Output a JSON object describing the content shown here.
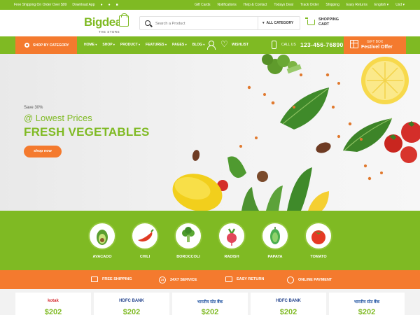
{
  "topbar": {
    "shipping_note": "Free Shipping On Order Over $99",
    "download_label": "Download App",
    "links": [
      "Gift Cards",
      "Notifications",
      "Help & Contact",
      "Todays Deal",
      "Track Order",
      "Shipping",
      "Easy Returns",
      "English",
      "Usd"
    ]
  },
  "header": {
    "logo_big": "Big",
    "logo_deal": "deal",
    "logo_tagline": "THE STORE",
    "search_placeholder": "Search a Product",
    "category_label": "ALL CATEGORY",
    "cart_line1": "SHOPPING",
    "cart_line2": "CART"
  },
  "nav": {
    "shop_by_category": "SHOP BY CATEGORY",
    "menu": [
      {
        "label": "HOME"
      },
      {
        "label": "SHOP"
      },
      {
        "label": "PRODUCT"
      },
      {
        "label": "FEATURES"
      },
      {
        "label": "PAGES"
      },
      {
        "label": "BLOG"
      }
    ],
    "wishlist_label": "WISHLIST",
    "call_label": "CALL US",
    "phone": "123-456-76890",
    "gift_small": "GIFT BOX",
    "gift_big": "Festivel Offer"
  },
  "hero": {
    "save": "Save 30%",
    "lowest": "@ Lowest Prices",
    "headline": "FRESH VEGETABLES",
    "button": "shop now"
  },
  "categories": [
    {
      "label": "AVACADO",
      "icon": "avocado-icon"
    },
    {
      "label": "CHILI",
      "icon": "chili-icon"
    },
    {
      "label": "BOROCCOLI",
      "icon": "broccoli-icon"
    },
    {
      "label": "RADISH",
      "icon": "radish-icon"
    },
    {
      "label": "PAPAYA",
      "icon": "papaya-icon"
    },
    {
      "label": "TOMATO",
      "icon": "tomato-icon"
    }
  ],
  "services": [
    {
      "label": "FREE SHIPPING",
      "icon": "truck-icon"
    },
    {
      "label": "24X7 SERVICE",
      "icon": "clock-24-icon"
    },
    {
      "label": "EASY RETURN",
      "icon": "return-icon"
    },
    {
      "label": "ONLINE PAYMENT",
      "icon": "payment-icon"
    }
  ],
  "offers": [
    {
      "bank": "kotak",
      "price": "$202"
    },
    {
      "bank": "HDFC BANK",
      "price": "$202"
    },
    {
      "bank": "भारतीय स्टेट बैंक",
      "price": "$202"
    },
    {
      "bank": "HDFC BANK",
      "price": "$202"
    },
    {
      "bank": "भारतीय स्टेट बैंक",
      "price": "$202"
    }
  ],
  "colors": {
    "green": "#7fba23",
    "orange": "#f47a2e"
  }
}
